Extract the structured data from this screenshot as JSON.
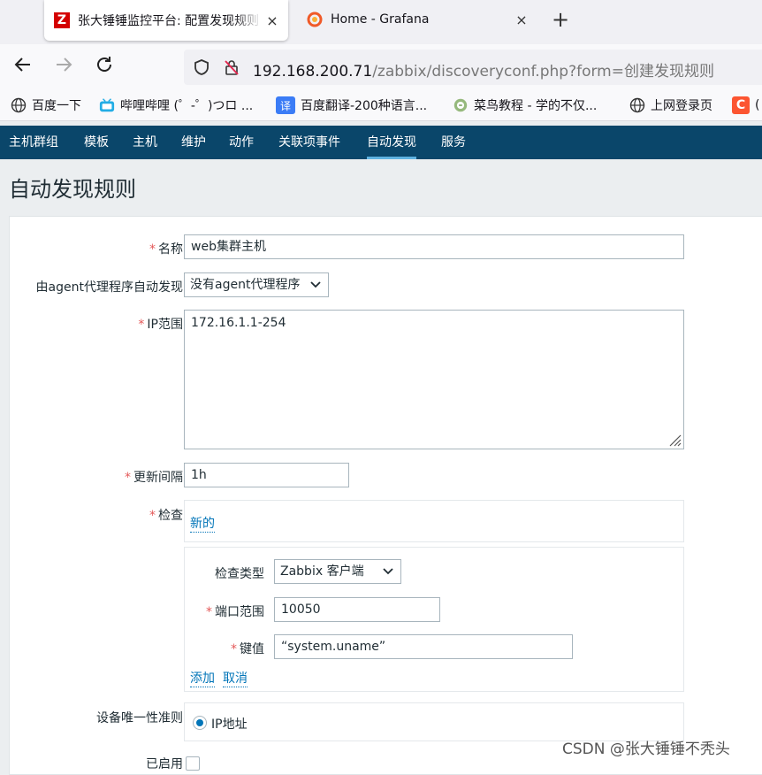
{
  "browser": {
    "tabs": [
      {
        "title": "张大锤锤监控平台: 配置发现规则",
        "close": "×",
        "active": true
      },
      {
        "title": "Home - Grafana",
        "close": "×",
        "active": false
      }
    ],
    "new_tab": "+",
    "url_host": "192.168.200.71",
    "url_path": "/zabbix/discoveryconf.php?form=创建发现规则",
    "bookmarks": [
      {
        "label": "百度一下",
        "icon": "globe-icon"
      },
      {
        "label": "哔哩哔哩 (゜-゜)つロ ...",
        "icon": "bilibili-icon"
      },
      {
        "label": "百度翻译-200种语言...",
        "icon": "translate-icon"
      },
      {
        "label": "菜鸟教程 - 学的不仅...",
        "icon": "runoob-icon"
      },
      {
        "label": "上网登录页",
        "icon": "globe-icon"
      },
      {
        "label": "(",
        "icon": "csdn-icon"
      }
    ]
  },
  "menu": {
    "items": [
      "主机群组",
      "模板",
      "主机",
      "维护",
      "动作",
      "关联项事件",
      "自动发现",
      "服务"
    ],
    "selected": "自动发现"
  },
  "page": {
    "title": "自动发现规则"
  },
  "form": {
    "name_label": "名称",
    "name_value": "web集群主机",
    "proxy_label": "由agent代理程序自动发现",
    "proxy_value": "没有agent代理程序",
    "ip_label": "IP范围",
    "ip_value": "172.16.1.1-254",
    "interval_label": "更新间隔",
    "interval_value": "1h",
    "checks_label": "检查",
    "new_link": "新的",
    "check_type_label": "检查类型",
    "check_type_value": "Zabbix 客户端",
    "port_label": "端口范围",
    "port_value": "10050",
    "key_label": "键值",
    "key_value": "“system.uname”",
    "add_link": "添加",
    "cancel_link": "取消",
    "uniqueness_label": "设备唯一性准则",
    "uniqueness_value": "IP地址",
    "enabled_label": "已启用"
  },
  "watermark": "CSDN @张大锤锤不秃头",
  "colors": {
    "menu_bg": "#0a466a",
    "link": "#0275b8",
    "required": "#e45959",
    "menu_selected": "#5fb2e0"
  }
}
